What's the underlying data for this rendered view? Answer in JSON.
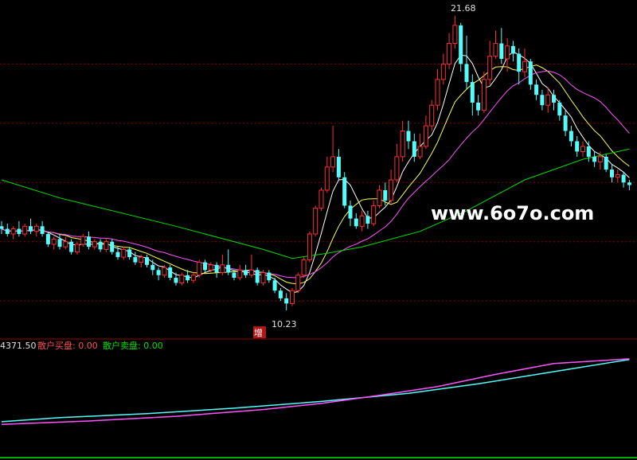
{
  "colors": {
    "background": "#000000",
    "grid": "#8b0000",
    "up": "#ff3030",
    "down": "#54fcfc",
    "ma_fast": "#ffffff",
    "ma_mid": "#ffff54",
    "ma_slow": "#ff54ff",
    "ma_long": "#00e000",
    "ind_a": "#54fcfc",
    "ind_b": "#ff54ff",
    "label_red": "#ff5050",
    "label_green": "#00e000",
    "watermark": "#ffffff"
  },
  "watermark": "www.6o7o.com",
  "indicator": {
    "value_label": "4371.50",
    "buy_label": "散户买盘: 0.00",
    "sell_label": "散户卖盘: 0.00"
  },
  "chart_data": {
    "type": "candlestick",
    "high_label": "21.68",
    "low_label": "10.23",
    "marker_label": "增",
    "y_range": [
      9.8,
      22.1
    ],
    "gridlines": [
      10.6,
      12.9,
      15.2,
      17.5,
      19.8
    ],
    "candles": [
      [
        13.5,
        13.4,
        13.7,
        13.2
      ],
      [
        13.4,
        13.2,
        13.6,
        13.1
      ],
      [
        13.2,
        13.4,
        13.5,
        13.0
      ],
      [
        13.4,
        13.2,
        13.7,
        13.1
      ],
      [
        13.2,
        13.5,
        13.6,
        13.1
      ],
      [
        13.5,
        13.3,
        13.8,
        13.2
      ],
      [
        13.3,
        13.5,
        13.6,
        13.1
      ],
      [
        13.5,
        13.2,
        13.7,
        13.1
      ],
      [
        13.2,
        12.8,
        13.3,
        12.7
      ],
      [
        12.8,
        13.0,
        13.1,
        12.6
      ],
      [
        13.0,
        12.7,
        13.2,
        12.6
      ],
      [
        12.7,
        12.9,
        13.1,
        12.6
      ],
      [
        12.9,
        12.5,
        13.0,
        12.4
      ],
      [
        12.5,
        12.8,
        12.9,
        12.4
      ],
      [
        12.8,
        13.1,
        13.2,
        12.7
      ],
      [
        13.1,
        12.7,
        13.3,
        12.6
      ],
      [
        12.7,
        12.9,
        13.0,
        12.6
      ],
      [
        12.9,
        12.6,
        13.0,
        12.5
      ],
      [
        12.6,
        12.9,
        13.0,
        12.5
      ],
      [
        12.9,
        12.5,
        13.0,
        12.4
      ],
      [
        12.5,
        12.3,
        12.7,
        12.2
      ],
      [
        12.3,
        12.6,
        12.7,
        12.2
      ],
      [
        12.6,
        12.3,
        12.7,
        12.2
      ],
      [
        12.3,
        12.1,
        12.5,
        12.0
      ],
      [
        12.1,
        12.3,
        12.4,
        11.9
      ],
      [
        12.3,
        12.0,
        12.4,
        11.9
      ],
      [
        12.0,
        11.8,
        12.2,
        11.6
      ],
      [
        11.8,
        11.6,
        11.9,
        11.4
      ],
      [
        11.6,
        11.9,
        12.0,
        11.5
      ],
      [
        11.9,
        11.5,
        12.0,
        11.4
      ],
      [
        11.5,
        11.3,
        11.7,
        11.2
      ],
      [
        11.3,
        11.6,
        11.7,
        11.2
      ],
      [
        11.6,
        11.4,
        11.8,
        11.3
      ],
      [
        11.4,
        11.6,
        11.7,
        11.3
      ],
      [
        11.6,
        12.1,
        12.2,
        11.5
      ],
      [
        12.1,
        11.8,
        12.2,
        11.7
      ],
      [
        11.8,
        12.0,
        12.1,
        11.7
      ],
      [
        12.0,
        11.7,
        12.1,
        11.5
      ],
      [
        11.7,
        12.0,
        12.4,
        11.6
      ],
      [
        12.0,
        11.7,
        12.6,
        11.6
      ],
      [
        11.7,
        11.5,
        11.8,
        11.4
      ],
      [
        11.5,
        11.8,
        12.0,
        11.4
      ],
      [
        11.8,
        11.6,
        12.0,
        11.5
      ],
      [
        11.6,
        11.8,
        12.4,
        11.5
      ],
      [
        11.8,
        11.3,
        11.9,
        11.2
      ],
      [
        11.3,
        11.7,
        11.8,
        11.2
      ],
      [
        11.7,
        11.4,
        11.8,
        11.3
      ],
      [
        11.4,
        11.0,
        11.5,
        10.9
      ],
      [
        11.0,
        10.7,
        11.1,
        10.6
      ],
      [
        10.7,
        10.5,
        10.9,
        10.23
      ],
      [
        10.5,
        11.0,
        11.1,
        10.4
      ],
      [
        11.0,
        11.6,
        11.7,
        10.9
      ],
      [
        11.6,
        12.2,
        12.3,
        11.5
      ],
      [
        12.2,
        13.2,
        13.3,
        12.1
      ],
      [
        13.2,
        14.2,
        14.3,
        13.1
      ],
      [
        14.2,
        14.9,
        15.0,
        14.1
      ],
      [
        14.9,
        15.8,
        16.2,
        14.8
      ],
      [
        15.8,
        16.2,
        17.4,
        15.6
      ],
      [
        16.2,
        15.4,
        16.5,
        15.3
      ],
      [
        15.4,
        14.3,
        15.6,
        14.2
      ],
      [
        14.3,
        13.8,
        14.5,
        13.5
      ],
      [
        13.8,
        13.5,
        14.0,
        13.4
      ],
      [
        13.5,
        13.9,
        14.1,
        13.3
      ],
      [
        13.9,
        13.6,
        14.1,
        13.4
      ],
      [
        13.6,
        14.3,
        14.5,
        13.5
      ],
      [
        14.3,
        14.9,
        15.1,
        14.2
      ],
      [
        14.9,
        14.5,
        15.2,
        14.3
      ],
      [
        14.5,
        15.3,
        15.7,
        14.4
      ],
      [
        15.3,
        16.2,
        16.7,
        15.2
      ],
      [
        16.2,
        17.2,
        17.6,
        16.0
      ],
      [
        17.2,
        16.8,
        17.6,
        16.5
      ],
      [
        16.8,
        16.2,
        17.1,
        16.0
      ],
      [
        16.2,
        16.6,
        17.1,
        16.1
      ],
      [
        16.6,
        17.4,
        17.8,
        16.5
      ],
      [
        17.4,
        18.2,
        18.4,
        17.2
      ],
      [
        18.2,
        19.2,
        19.6,
        18.0
      ],
      [
        19.2,
        19.8,
        20.2,
        19.0
      ],
      [
        19.8,
        20.6,
        21.0,
        19.6
      ],
      [
        20.6,
        21.3,
        21.68,
        20.4
      ],
      [
        21.3,
        19.8,
        21.4,
        19.5
      ],
      [
        19.8,
        19.1,
        20.9,
        18.8
      ],
      [
        19.1,
        18.3,
        19.4,
        17.8
      ],
      [
        18.3,
        18.0,
        18.6,
        17.8
      ],
      [
        18.0,
        19.2,
        19.5,
        17.9
      ],
      [
        19.2,
        20.1,
        20.7,
        19.0
      ],
      [
        20.1,
        20.6,
        21.1,
        20.0
      ],
      [
        20.6,
        20.0,
        21.2,
        19.8
      ],
      [
        20.0,
        20.5,
        20.8,
        19.5
      ],
      [
        20.5,
        20.2,
        20.7,
        19.9
      ],
      [
        20.2,
        19.5,
        20.4,
        19.0
      ],
      [
        19.5,
        19.9,
        20.4,
        19.3
      ],
      [
        19.9,
        19.0,
        20.0,
        18.8
      ],
      [
        19.0,
        18.6,
        19.2,
        18.4
      ],
      [
        18.6,
        18.2,
        18.8,
        18.0
      ],
      [
        18.2,
        18.6,
        18.9,
        17.9
      ],
      [
        18.6,
        18.3,
        18.8,
        18.0
      ],
      [
        18.3,
        17.8,
        18.4,
        17.6
      ],
      [
        17.8,
        17.2,
        18.0,
        17.0
      ],
      [
        17.2,
        16.8,
        17.4,
        16.6
      ],
      [
        16.8,
        16.4,
        17.0,
        16.2
      ],
      [
        16.4,
        16.6,
        16.8,
        16.2
      ],
      [
        16.6,
        16.2,
        16.8,
        16.0
      ],
      [
        16.2,
        16.0,
        16.4,
        15.8
      ],
      [
        16.0,
        16.2,
        16.4,
        15.7
      ],
      [
        16.2,
        15.7,
        16.3,
        15.6
      ],
      [
        15.7,
        15.4,
        15.9,
        15.2
      ],
      [
        15.4,
        15.5,
        15.7,
        15.2
      ],
      [
        15.5,
        15.2,
        15.6,
        15.0
      ],
      [
        15.2,
        15.1,
        15.3,
        14.9
      ]
    ],
    "ma_long": [
      [
        0,
        15.3
      ],
      [
        10,
        14.6
      ],
      [
        30,
        13.5
      ],
      [
        45,
        12.6
      ],
      [
        50,
        12.25
      ],
      [
        56,
        12.45
      ],
      [
        62,
        12.7
      ],
      [
        72,
        13.3
      ],
      [
        80,
        14.1
      ],
      [
        90,
        15.3
      ],
      [
        100,
        16.1
      ],
      [
        108,
        16.5
      ]
    ],
    "indicator_series": [
      {
        "color_key": "ind_a",
        "points": [
          [
            0,
            0.06
          ],
          [
            10,
            0.12
          ],
          [
            25,
            0.18
          ],
          [
            40,
            0.26
          ],
          [
            55,
            0.36
          ],
          [
            70,
            0.48
          ],
          [
            82,
            0.62
          ],
          [
            95,
            0.8
          ],
          [
            108,
            0.98
          ]
        ]
      },
      {
        "color_key": "ind_b",
        "points": [
          [
            0,
            0.02
          ],
          [
            15,
            0.07
          ],
          [
            30,
            0.14
          ],
          [
            45,
            0.24
          ],
          [
            55,
            0.33
          ],
          [
            65,
            0.45
          ],
          [
            75,
            0.58
          ],
          [
            85,
            0.76
          ],
          [
            95,
            0.92
          ],
          [
            108,
            0.99
          ]
        ]
      }
    ]
  }
}
